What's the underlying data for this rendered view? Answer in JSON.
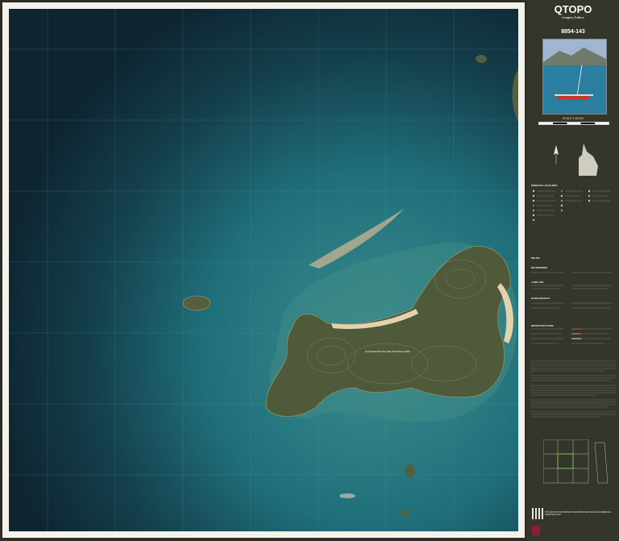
{
  "sheet": {
    "brand": "QTOPO",
    "edition": "Imagery Edition",
    "map_number": "8854-143",
    "scale": "SCALE 1:15,000",
    "island_label": "GLOUCESTER ISLAND NATIONAL PARK"
  },
  "colors": {
    "deep_sea": "#0f2a36",
    "shallow_sea": "#1f6f7a",
    "reef": "#3f8a86",
    "land": "#4f5a3a",
    "sand": "#d8c7a4",
    "sidebar_bg": "#34352b",
    "frame": "#f4f2ea"
  },
  "legend": {
    "sections": [
      "PRINCIPAL FEATURES",
      "RELIEF",
      "BOUNDARIES",
      "LAND USE",
      "HYDROGRAPHY",
      "INFRASTRUCTURE"
    ]
  },
  "icons": [
    "compass-rose-icon",
    "queensland-locator-icon",
    "qr-code-icon",
    "crest-icon"
  ],
  "footer": {
    "notice": "THIS MAP MAY BE PRINTED OR REPRODUCED FOR NON-COMMERCIAL PURPOSES ONLY"
  }
}
